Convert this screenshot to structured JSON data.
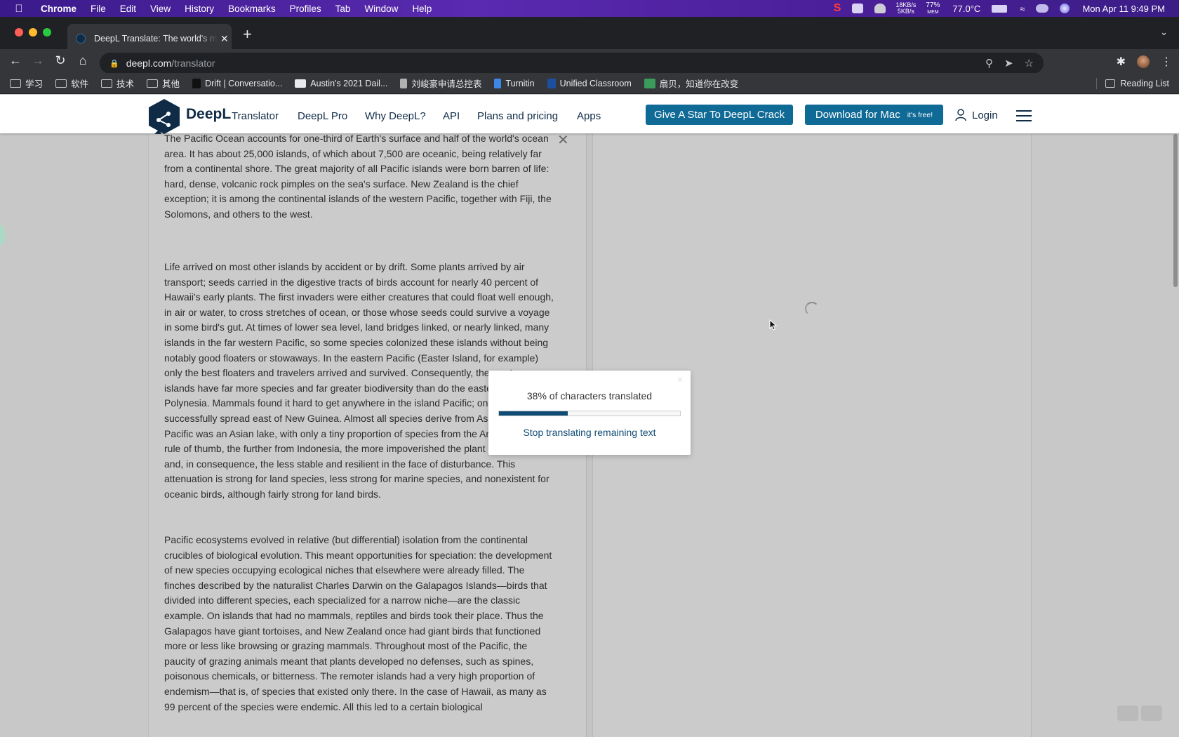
{
  "menubar": {
    "app": "Chrome",
    "items": [
      "File",
      "Edit",
      "View",
      "History",
      "Bookmarks",
      "Profiles",
      "Tab",
      "Window",
      "Help"
    ],
    "net_up": "18KB/s",
    "net_down": "5KB/s",
    "mem_pct": "77%",
    "mem_label": "MEM",
    "temp": "77.0°C",
    "datetime": "Mon Apr 11  9:49 PM"
  },
  "browser": {
    "tab_title": "DeepL Translate: The world's most accurate translator",
    "url_host": "deepl.com",
    "url_path": "/translator",
    "bookmarks": [
      "学习",
      "软件",
      "技术",
      "其他",
      "Drift | Conversatio...",
      "Austin's 2021 Dail...",
      "刘峻豪申请总控表",
      "Turnitin",
      "Unified Classroom",
      "扇贝，知道你在改变"
    ],
    "reading_list": "Reading List"
  },
  "header": {
    "brand": "DeepL",
    "brand_sub": "Translator",
    "nav": [
      "DeepL Pro",
      "Why DeepL?",
      "API",
      "Plans and pricing",
      "Apps"
    ],
    "star_button": "Give A Star To DeepL Crack",
    "download_button": "Download for Mac",
    "download_note": "it's free!",
    "login": "Login"
  },
  "source_text": {
    "p1": "The Pacific Ocean accounts for one-third of Earth's surface and half of the world's ocean area. It has about 25,000 islands, of which about 7,500 are oceanic, being relatively far from a continental shore. The great majority of all Pacific islands were born barren of life: hard, dense, volcanic rock pimples on the sea's surface. New Zealand is the chief exception; it is among the continental islands of the western Pacific, together with Fiji, the Solomons, and others to the west.",
    "p2": "Life arrived on most other islands by accident or by drift. Some plants arrived by air transport; seeds carried in the digestive tracts of birds account for nearly 40 percent of Hawaii's early plants. The first invaders were either creatures that could float well enough, in air or water, to cross stretches of ocean, or those whose seeds could survive a voyage in some bird's gut. At times of lower sea level, land bridges linked, or nearly linked, many islands in the far western Pacific, so some species colonized these islands without being notably good floaters or stowaways. In the eastern Pacific (Easter Island, for example) only the best floaters and travelers arrived and survived. Consequently, the western islands have far more species and far greater biodiversity than do the eastern islands of Polynesia. Mammals found it hard to get anywhere in the island Pacific; only bats and rats successfully spread east of New Guinea. Almost all species derive from Asia; the early Pacific was an Asian lake, with only a tiny proportion of species from the Americas. As a rule of thumb, the further from Indonesia, the more impoverished the plant and animal life and, in consequence, the less stable and resilient in the face of disturbance. This attenuation is strong for land species, less strong for marine species, and nonexistent for oceanic birds, although fairly strong for land birds.",
    "p3": "Pacific ecosystems evolved in relative (but differential) isolation from the continental crucibles of biological evolution. This meant opportunities for speciation: the development of new species occupying ecological niches that elsewhere were already filled. The finches described by the naturalist Charles Darwin on the Galapagos Islands—birds that divided into different species, each specialized for a narrow niche—are the classic example. On islands that had no mammals, reptiles and birds took their place. Thus the Galapagos have giant tortoises, and New Zealand once had giant birds that functioned more or less like browsing or grazing mammals. Throughout most of the Pacific, the paucity of grazing animals meant that plants developed no defenses, such as spines, poisonous chemicals, or bitterness. The remoter islands had a very high proportion of endemism—that is,  of species that existed only there. In the case of Hawaii, as many as 99 percent of the species were endemic. All this led to a certain biological"
  },
  "progress_modal": {
    "message": "38% of characters translated",
    "progress_fraction": 0.38,
    "stop_label": "Stop translating remaining text"
  }
}
